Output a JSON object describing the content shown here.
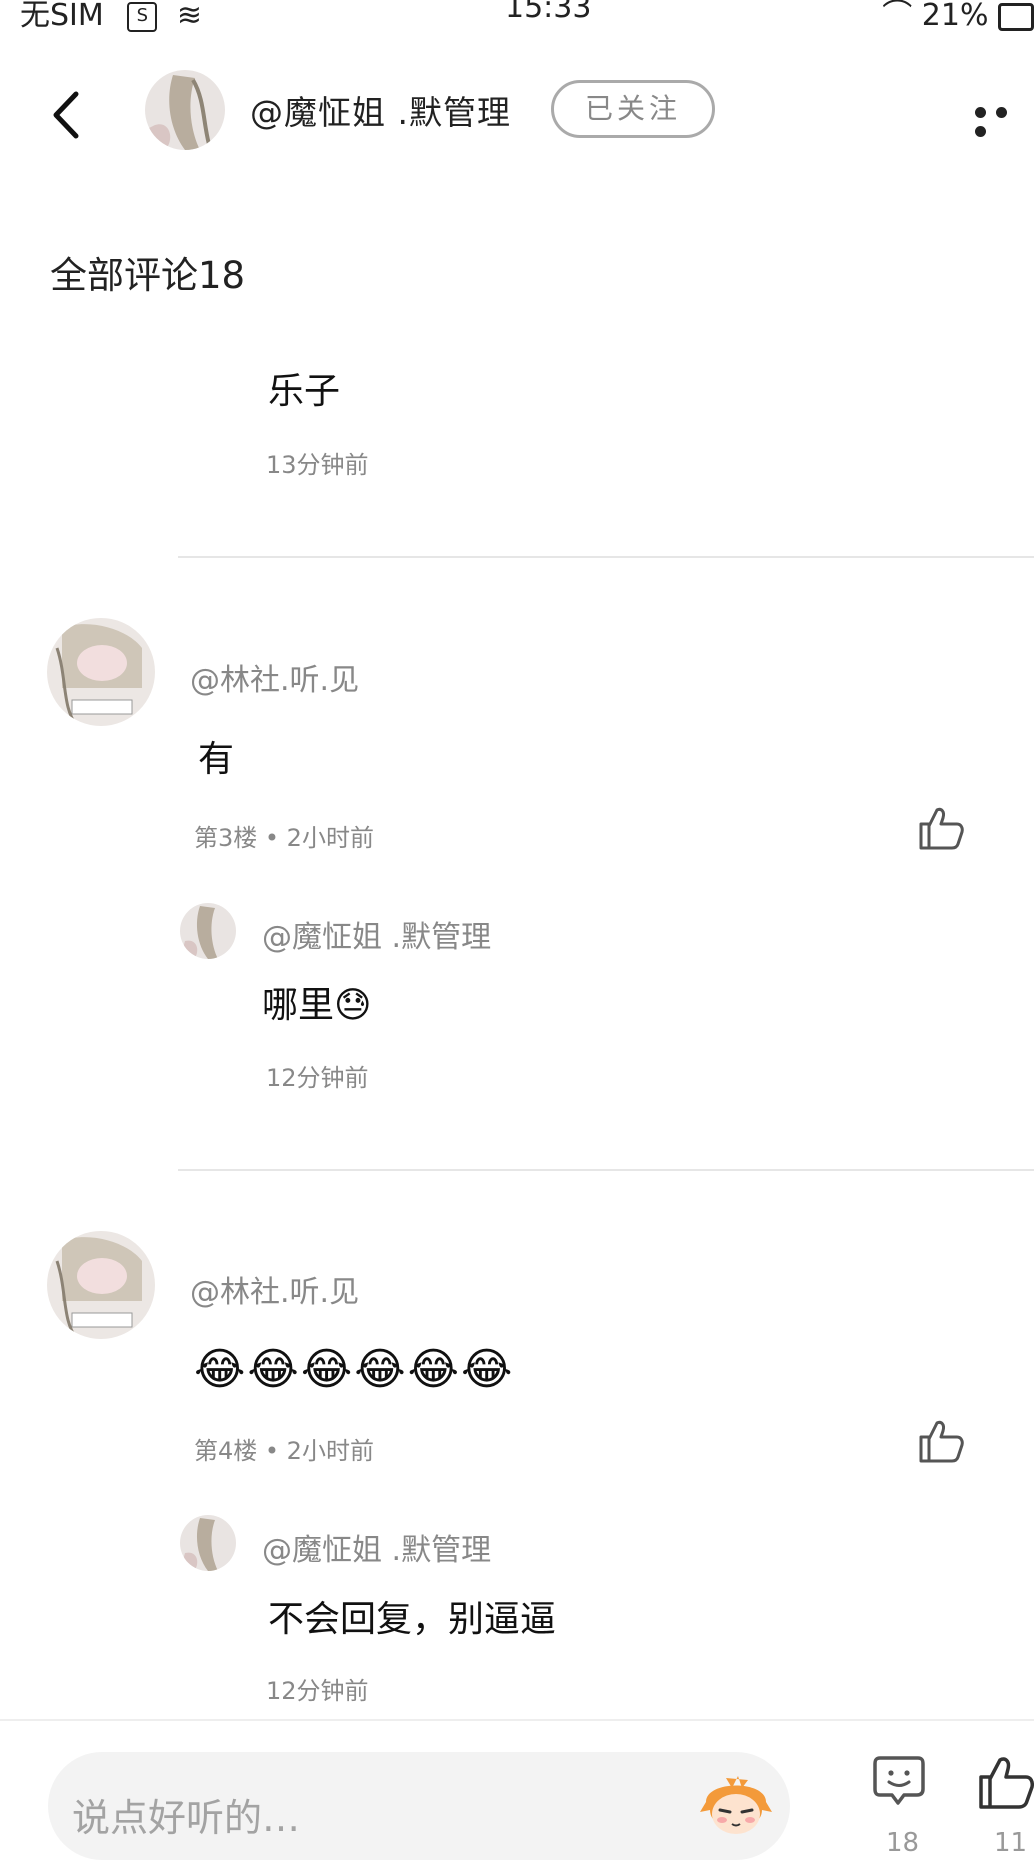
{
  "status_bar": {
    "carrier": "无SIM",
    "time": "15:33",
    "battery": "21%"
  },
  "header": {
    "username": "@魔怔姐 .默管理",
    "follow_label": "已关注"
  },
  "comments_title": "全部评论18",
  "top_reply": {
    "text": "乐子",
    "time": "13分钟前"
  },
  "comments": [
    {
      "username": "@林社.听.见",
      "text": "有",
      "meta": "第3楼 • 2小时前",
      "reply": {
        "username": "@魔怔姐 .默管理",
        "text": "哪里😓",
        "time": "12分钟前"
      }
    },
    {
      "username": "@林社.听.见",
      "text": "😂😂😂😂😂😂",
      "meta": "第4楼 • 2小时前",
      "reply": {
        "username": "@魔怔姐 .默管理",
        "text": "不会回复，别逼逼",
        "time": "12分钟前"
      }
    }
  ],
  "bottom_bar": {
    "input_placeholder": "说点好听的…",
    "comment_count": "18",
    "like_count": "11"
  },
  "icons": {
    "back": "chevron-left-icon",
    "more": "more-dots-icon",
    "like": "thumbs-up-icon",
    "comment": "comment-bubble-icon",
    "mascot": "emoji-mascot-icon"
  }
}
